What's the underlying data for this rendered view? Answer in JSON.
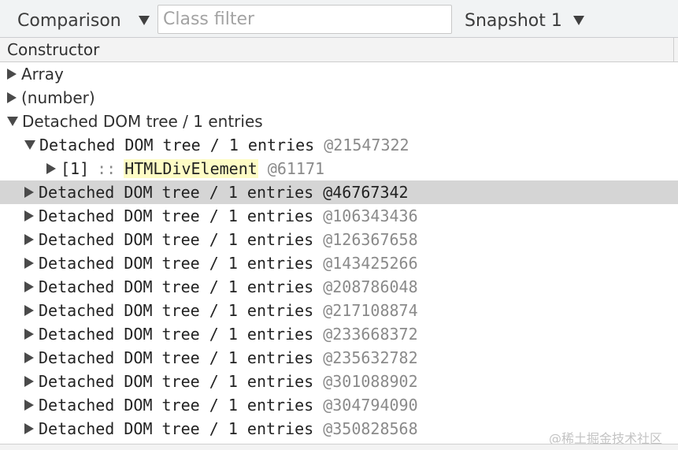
{
  "toolbar": {
    "view_label": "Comparison",
    "class_filter_placeholder": "Class filter",
    "snapshot_label": "Snapshot 1"
  },
  "header": {
    "column_label": "Constructor"
  },
  "tree": {
    "array_label": "Array",
    "number_label": "(number)",
    "group_label": "Detached DOM tree / 1 entries",
    "expanded_child": {
      "label": "Detached DOM tree / 1 entries",
      "id": "@21547322"
    },
    "element_row": {
      "index": "[1]",
      "separator": "::",
      "element": "HTMLDivElement",
      "id": "@61171"
    },
    "collapsed_children": [
      {
        "label": "Detached DOM tree / 1 entries",
        "id": "@46767342"
      },
      {
        "label": "Detached DOM tree / 1 entries",
        "id": "@106343436"
      },
      {
        "label": "Detached DOM tree / 1 entries",
        "id": "@126367658"
      },
      {
        "label": "Detached DOM tree / 1 entries",
        "id": "@143425266"
      },
      {
        "label": "Detached DOM tree / 1 entries",
        "id": "@208786048"
      },
      {
        "label": "Detached DOM tree / 1 entries",
        "id": "@217108874"
      },
      {
        "label": "Detached DOM tree / 1 entries",
        "id": "@233668372"
      },
      {
        "label": "Detached DOM tree / 1 entries",
        "id": "@235632782"
      },
      {
        "label": "Detached DOM tree / 1 entries",
        "id": "@301088902"
      },
      {
        "label": "Detached DOM tree / 1 entries",
        "id": "@304794090"
      },
      {
        "label": "Detached DOM tree / 1 entries",
        "id": "@350828568"
      }
    ]
  },
  "watermark": "@稀土掘金技术社区",
  "colors": {
    "selected_row": "#d5d5d5",
    "element_highlight": "#fefcc5",
    "accent": "#1a73e8"
  }
}
